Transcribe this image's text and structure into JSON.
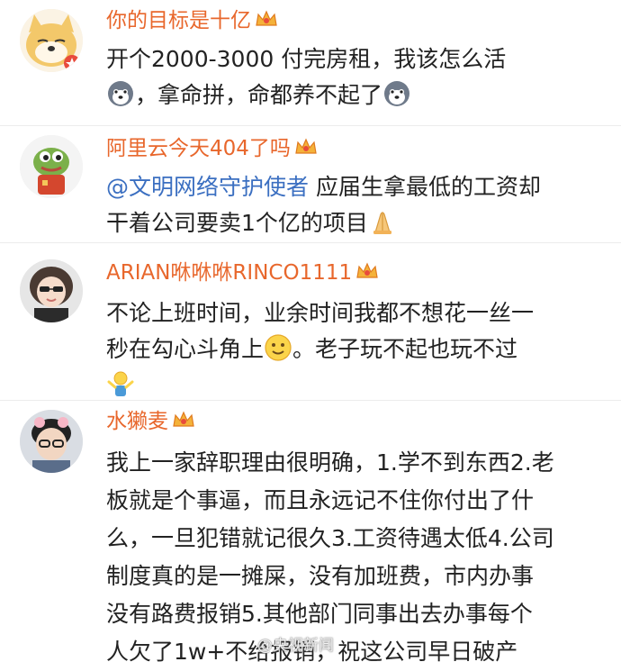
{
  "comments": [
    {
      "username": "你的目标是十亿",
      "lines": [
        "开个2000-3000 付完房租，我该怎么活",
        "，拿命拼，命都养不起了"
      ],
      "emoji": "husky-face"
    },
    {
      "username": "阿里云今天404了吗",
      "mention": "@文明网络守护使者",
      "lines": [
        " 应届生拿最低的工资却",
        "干着公司要卖1个亿的项目"
      ],
      "emoji": "folded-hands"
    },
    {
      "username": "ARIAN咻咻咻RINCO1111",
      "lines": [
        "不论上班时间，业余时间我都不想花一丝一",
        "秒在勾心斗角上",
        "。老子玩不起也玩不过"
      ],
      "emoji": [
        "smile-face",
        "shrug-person"
      ]
    },
    {
      "username": "水獭麦",
      "lines": [
        "我上一家辞职理由很明确，1.学不到东西2.老",
        "板就是个事逼，而且永远记不住你付出了什",
        "么，一旦犯错就记很久3.工资待遇太低4.公司",
        "制度真的是一摊屎，没有加班费，市内办事",
        "没有路费报销5.其他部门同事出去办事每个",
        "人欠了1w+不给报销，祝这公司早日破产"
      ]
    }
  ],
  "watermark": "@央视新闻",
  "colors": {
    "username": "#e8672c",
    "mention": "#3b6fc1",
    "text": "#222222"
  }
}
